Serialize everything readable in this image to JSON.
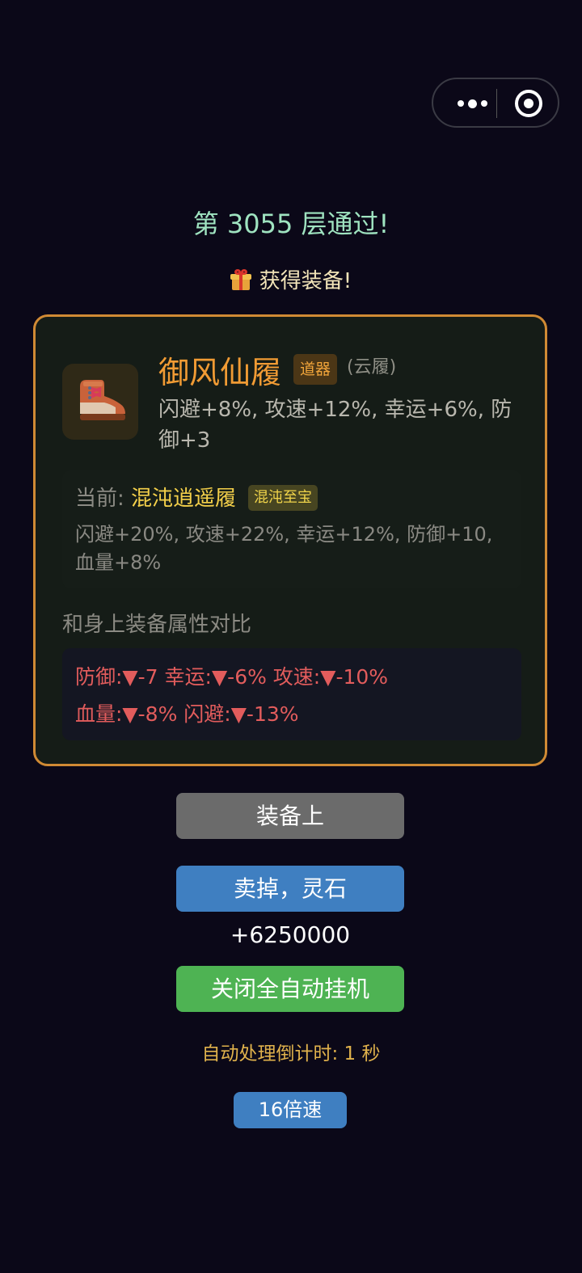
{
  "header": {
    "floor_title": "第 3055 层通过!",
    "gain_text": "获得装备!",
    "gain_icon": "gift-icon"
  },
  "item": {
    "name": "御风仙履",
    "rank": "道器",
    "subtype": "(云履)",
    "stats": "闪避+8%, 攻速+12%, 幸运+6%, 防御+3",
    "icon": "boot-icon"
  },
  "current": {
    "prefix": "当前: ",
    "name": "混沌逍遥履",
    "rank": "混沌至宝",
    "stats": "闪避+20%, 攻速+22%, 幸运+12%, 防御+10, 血量+8%"
  },
  "compare": {
    "title": "和身上装备属性对比",
    "line1": "防御:▼-7 幸运:▼-6% 攻速:▼-10%",
    "line2": "血量:▼-8% 闪避:▼-13%"
  },
  "actions": {
    "equip": "装备上",
    "sell": "卖掉，灵石+6250000",
    "auto": "关闭全自动挂机",
    "countdown": "自动处理倒计时: 1 秒",
    "speed": "16倍速"
  },
  "colors": {
    "background": "#0b0818",
    "card_border": "#d08a34",
    "item_name": "#f19b34",
    "current_name": "#f4d04a",
    "stat_down": "#e25c5c",
    "equip_button": "#6b6b6b",
    "sell_button": "#3f7fc1",
    "auto_button": "#4eb353",
    "countdown_text": "#e0b24c"
  }
}
